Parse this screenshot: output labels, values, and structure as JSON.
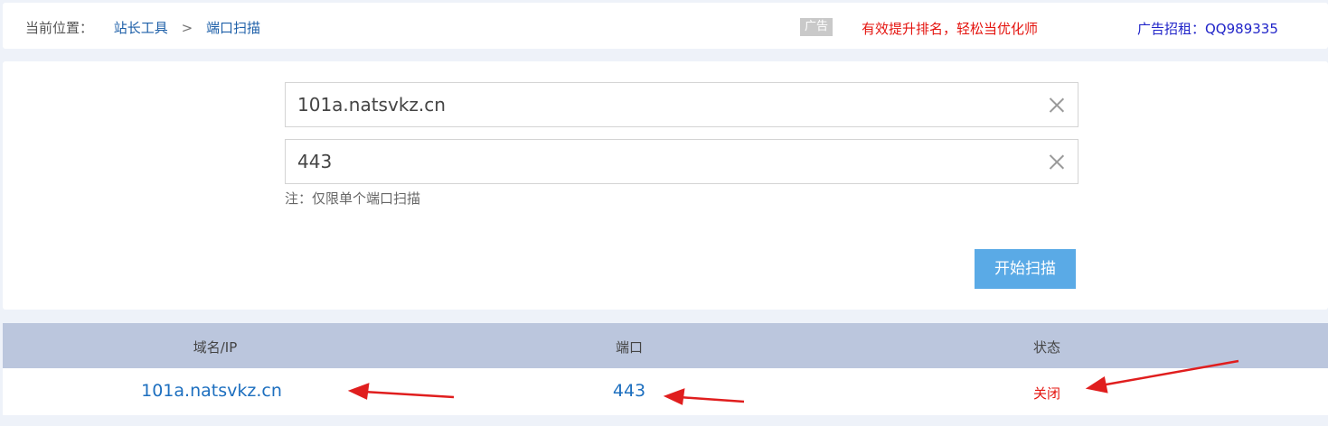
{
  "breadcrumb": {
    "label": "当前位置：",
    "items": [
      "站长工具",
      "端口扫描"
    ],
    "separator": ">"
  },
  "ads": {
    "badge": "广告",
    "promo": "有效提升排名，轻松当优化师",
    "rent": "广告招租：QQ989335"
  },
  "form": {
    "domain_value": "101a.natsvkz.cn",
    "port_value": "443",
    "note": "注：仅限单个端口扫描",
    "scan_button": "开始扫描"
  },
  "table": {
    "headers": [
      "域名/IP",
      "端口",
      "状态"
    ],
    "rows": [
      {
        "domain": "101a.natsvkz.cn",
        "port": "443",
        "status": "关闭"
      }
    ]
  },
  "colors": {
    "link": "#1d5fa8",
    "ad_red": "#e4140f",
    "ad_blue": "#2125c9",
    "button": "#5aaae6",
    "table_header": "#bbc6dd",
    "annotation_arrow": "#e01e1e"
  }
}
